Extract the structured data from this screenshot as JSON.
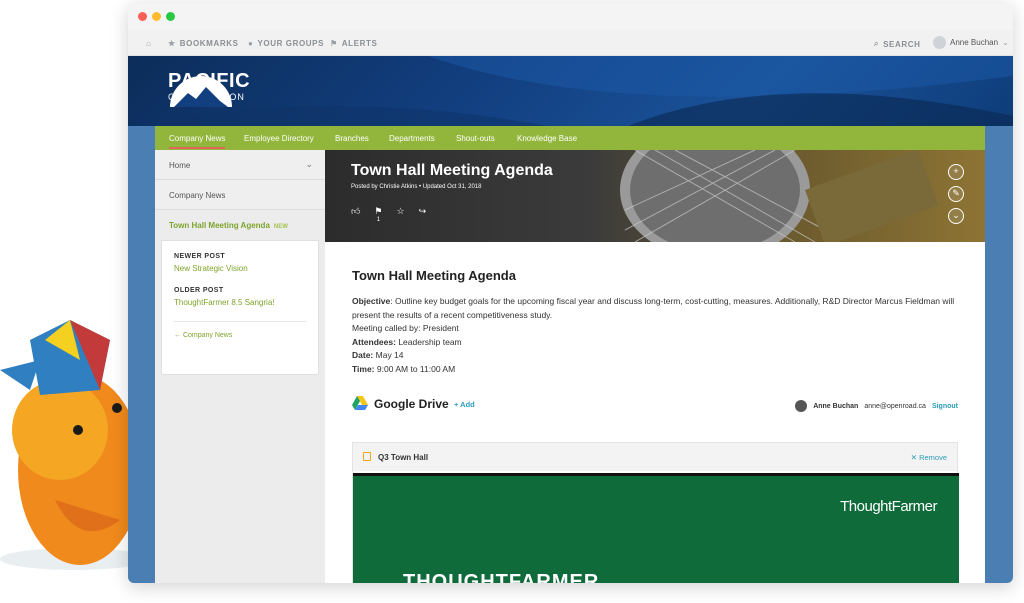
{
  "topbar": {
    "bookmarks": "BOOKMARKS",
    "groups": "YOUR GROUPS",
    "alerts": "ALERTS",
    "search": "SEARCH",
    "user": "Anne Buchan"
  },
  "brand": {
    "name": "PACIFIC",
    "sub": "CREDIT UNION"
  },
  "nav": [
    "Company News",
    "Employee Directory",
    "Branches",
    "Departments",
    "Shout-outs",
    "Knowledge Base"
  ],
  "sidebar": {
    "home": "Home",
    "section": "Company News",
    "current": "Town Hall Meeting Agenda",
    "current_badge": "NEW",
    "newer_label": "NEWER POST",
    "newer_link": "New Strategic Vision",
    "older_label": "OLDER POST",
    "older_link": "ThoughtFarmer 8.5 Sangria!",
    "back": "Company News"
  },
  "hero": {
    "title": "Town Hall Meeting Agenda",
    "meta": "Posted by Christie Atkins  •  Updated Oct 31, 2018",
    "flag_count": "1"
  },
  "article": {
    "heading": "Town Hall Meeting Agenda",
    "objective_label": "Objective",
    "objective_text": ": Outline key budget goals for the upcoming fiscal year and discuss long-term, cost-cutting, measures. Additionally, R&D Director Marcus Fieldman will present the results of a recent competitiveness study.",
    "called_by": "Meeting called by: President",
    "attendees_label": "Attendees:",
    "attendees_text": "Leadership team",
    "date_label": "Date:",
    "date_text": "May 14",
    "time_label": "Time:",
    "time_text": "9:00 AM to 11:00 AM"
  },
  "drive": {
    "name": "Google Drive",
    "add": "+ Add",
    "user": "Anne Buchan",
    "email": "anne@openroad.ca",
    "signout": "Signout"
  },
  "doc": {
    "name": "Q3 Town Hall",
    "remove": "✕ Remove",
    "slide_brand": "ThoughtFarmer",
    "slide_title": "THOUGHTFARMER"
  },
  "colors": {
    "green": "#92b63b",
    "link": "#2a9cb8",
    "accent": "#7ea32b"
  }
}
